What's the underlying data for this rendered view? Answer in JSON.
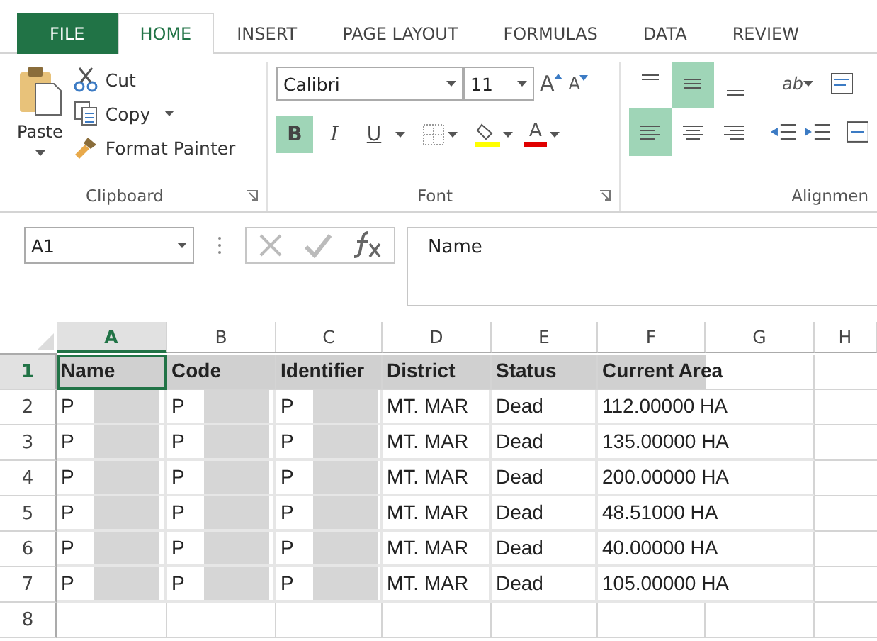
{
  "tabs": [
    {
      "label": "FILE",
      "kind": "file",
      "selected": false
    },
    {
      "label": "HOME",
      "kind": "tab",
      "selected": true
    },
    {
      "label": "INSERT",
      "kind": "tab",
      "selected": false
    },
    {
      "label": "PAGE LAYOUT",
      "kind": "tab",
      "selected": false
    },
    {
      "label": "FORMULAS",
      "kind": "tab",
      "selected": false
    },
    {
      "label": "DATA",
      "kind": "tab",
      "selected": false
    },
    {
      "label": "REVIEW",
      "kind": "tab",
      "selected": false
    }
  ],
  "font_buttons": {
    "grow": "A",
    "shrink": "A",
    "font_color": "A"
  },
  "orientation_label": "ab",
  "clipboard": {
    "label": "Clipboard",
    "paste": "Paste",
    "cut": "Cut",
    "copy": "Copy",
    "format_painter": "Format Painter"
  },
  "font": {
    "label": "Font",
    "font_name": "Calibri",
    "font_size": "11",
    "styles": [
      {
        "kind": "bold",
        "label": "B",
        "selected": true
      },
      {
        "kind": "italic",
        "label": "I",
        "selected": false
      },
      {
        "kind": "underline",
        "label": "U",
        "selected": false
      }
    ]
  },
  "alignment": {
    "label": "Alignmen",
    "vertical": [
      {
        "kind": "top",
        "selected": false
      },
      {
        "kind": "middle",
        "selected": true
      },
      {
        "kind": "bottom",
        "selected": false
      }
    ],
    "horizontal": [
      {
        "kind": "left",
        "selected": true
      },
      {
        "kind": "center",
        "selected": false
      },
      {
        "kind": "right",
        "selected": false
      }
    ]
  },
  "formula_bar": {
    "name_box": "A1",
    "value": "Name"
  },
  "sheet": {
    "columns": [
      {
        "label": "A",
        "selected": true
      },
      {
        "label": "B",
        "selected": false
      },
      {
        "label": "C",
        "selected": false
      },
      {
        "label": "D",
        "selected": false
      },
      {
        "label": "E",
        "selected": false
      },
      {
        "label": "F",
        "selected": false
      },
      {
        "label": "G",
        "selected": false
      },
      {
        "label": "H",
        "selected": false
      }
    ],
    "rows": [
      {
        "number": "1",
        "selected": true,
        "header": true,
        "cells": [
          "Name",
          "Code",
          "Identifier",
          "District",
          "Status",
          "Current Area"
        ]
      },
      {
        "number": "2",
        "selected": false,
        "header": false,
        "cells": [
          "P",
          "P",
          "P",
          "MT. MAR",
          "Dead",
          "112.00000 HA"
        ]
      },
      {
        "number": "3",
        "selected": false,
        "header": false,
        "cells": [
          "P",
          "P",
          "P",
          "MT. MAR",
          "Dead",
          "135.00000 HA"
        ]
      },
      {
        "number": "4",
        "selected": false,
        "header": false,
        "cells": [
          "P",
          "P",
          "P",
          "MT. MAR",
          "Dead",
          "200.00000 HA"
        ]
      },
      {
        "number": "5",
        "selected": false,
        "header": false,
        "cells": [
          "P",
          "P",
          "P",
          "MT. MAR",
          "Dead",
          "48.51000 HA"
        ]
      },
      {
        "number": "6",
        "selected": false,
        "header": false,
        "cells": [
          "P",
          "P",
          "P",
          "MT. MAR",
          "Dead",
          "40.00000 HA"
        ]
      },
      {
        "number": "7",
        "selected": false,
        "header": false,
        "cells": [
          "P",
          "P",
          "P",
          "MT. MAR",
          "Dead",
          "105.00000 HA"
        ]
      },
      {
        "number": "8",
        "selected": false,
        "cells": []
      }
    ]
  }
}
